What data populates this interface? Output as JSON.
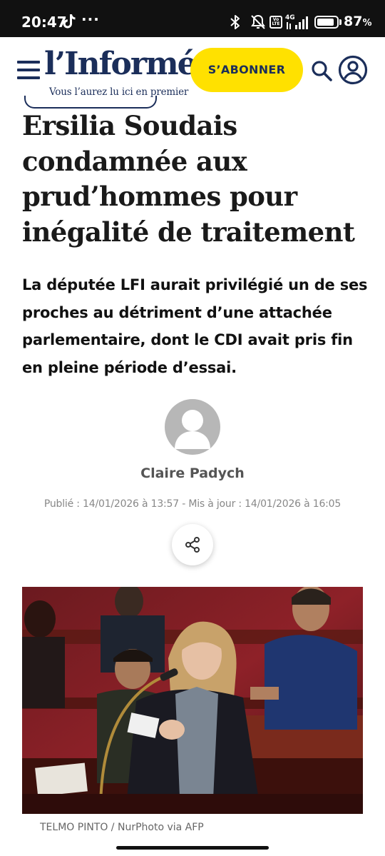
{
  "status_bar": {
    "time": "20:47",
    "more": "···",
    "network": "4G",
    "volte": "Vo LTE",
    "battery_level": 87,
    "battery_number": "87",
    "battery_unit": "%"
  },
  "header": {
    "logo": "l’Informé",
    "tagline": "Vous l’aurez lu ici en premier",
    "subscribe_label": "S’ABONNER",
    "brand_color": "#1b2e5a",
    "accent_color": "#ffe100"
  },
  "article": {
    "headline": "Ersilia Soudais condamnée aux prud’hommes pour inégalité de traitement",
    "standfirst": "La députée LFI aurait privilégié un de ses proches au détriment d’une attachée parlementaire, dont le CDI avait pris fin en pleine période d’essai.",
    "author": "Claire Padych",
    "dates": "Publié : 14/01/2026 à 13:57 - Mis à jour : 14/01/2026 à 16:05",
    "photo_credit": "TELMO PINTO / NurPhoto via AFP"
  },
  "icons": {
    "menu": "menu-icon",
    "search": "search-icon",
    "account": "account-icon",
    "share": "share-icon",
    "avatar": "default-avatar-icon"
  }
}
